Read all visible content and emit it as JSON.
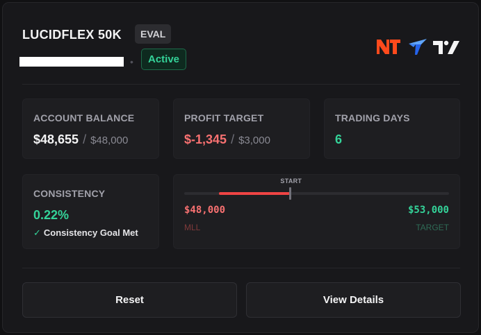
{
  "account": {
    "title": "LUCIDFLEX 50K",
    "type_badge": "EVAL",
    "status": "Active",
    "separator": "•"
  },
  "logos": [
    {
      "name": "ninjatrader-logo",
      "text": "NT",
      "color": "#ff4a1c"
    },
    {
      "name": "tradovate-logo",
      "color": "#3b82f6"
    },
    {
      "name": "tradingview-logo",
      "text": "TV",
      "color": "#f4f4f5"
    }
  ],
  "stats": {
    "balance": {
      "label": "ACCOUNT BALANCE",
      "value": "$48,655",
      "separator": "/",
      "sub": "$48,000"
    },
    "profit": {
      "label": "PROFIT TARGET",
      "value": "$-1,345",
      "separator": "/",
      "sub": "$3,000"
    },
    "days": {
      "label": "TRADING DAYS",
      "value": "6"
    },
    "consistency": {
      "label": "CONSISTENCY",
      "value": "0.22%",
      "check": "✓",
      "goal": "Consistency Goal Met"
    }
  },
  "progress": {
    "start_label": "START",
    "min_value": "$48,000",
    "min_label": "MLL",
    "max_value": "$53,000",
    "max_label": "TARGET",
    "start_fraction": 0.4,
    "current_fraction": 0.131
  },
  "buttons": {
    "reset": "Reset",
    "details": "View Details"
  },
  "colors": {
    "accent_green": "#34d399",
    "accent_red": "#f87171",
    "background": "#18181b"
  }
}
